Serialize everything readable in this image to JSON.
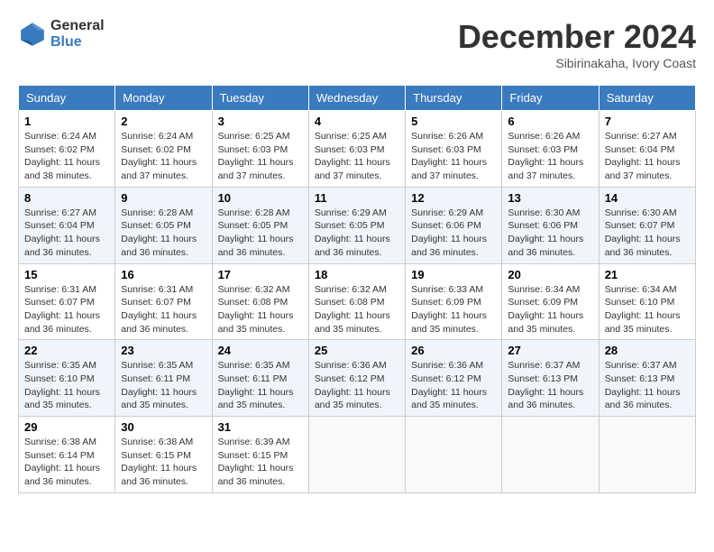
{
  "logo": {
    "general": "General",
    "blue": "Blue"
  },
  "title": "December 2024",
  "location": "Sibirinakaha, Ivory Coast",
  "weekdays": [
    "Sunday",
    "Monday",
    "Tuesday",
    "Wednesday",
    "Thursday",
    "Friday",
    "Saturday"
  ],
  "weeks": [
    [
      {
        "day": "1",
        "sunrise": "6:24 AM",
        "sunset": "6:02 PM",
        "daylight": "11 hours and 38 minutes."
      },
      {
        "day": "2",
        "sunrise": "6:24 AM",
        "sunset": "6:02 PM",
        "daylight": "11 hours and 37 minutes."
      },
      {
        "day": "3",
        "sunrise": "6:25 AM",
        "sunset": "6:03 PM",
        "daylight": "11 hours and 37 minutes."
      },
      {
        "day": "4",
        "sunrise": "6:25 AM",
        "sunset": "6:03 PM",
        "daylight": "11 hours and 37 minutes."
      },
      {
        "day": "5",
        "sunrise": "6:26 AM",
        "sunset": "6:03 PM",
        "daylight": "11 hours and 37 minutes."
      },
      {
        "day": "6",
        "sunrise": "6:26 AM",
        "sunset": "6:03 PM",
        "daylight": "11 hours and 37 minutes."
      },
      {
        "day": "7",
        "sunrise": "6:27 AM",
        "sunset": "6:04 PM",
        "daylight": "11 hours and 37 minutes."
      }
    ],
    [
      {
        "day": "8",
        "sunrise": "6:27 AM",
        "sunset": "6:04 PM",
        "daylight": "11 hours and 36 minutes."
      },
      {
        "day": "9",
        "sunrise": "6:28 AM",
        "sunset": "6:05 PM",
        "daylight": "11 hours and 36 minutes."
      },
      {
        "day": "10",
        "sunrise": "6:28 AM",
        "sunset": "6:05 PM",
        "daylight": "11 hours and 36 minutes."
      },
      {
        "day": "11",
        "sunrise": "6:29 AM",
        "sunset": "6:05 PM",
        "daylight": "11 hours and 36 minutes."
      },
      {
        "day": "12",
        "sunrise": "6:29 AM",
        "sunset": "6:06 PM",
        "daylight": "11 hours and 36 minutes."
      },
      {
        "day": "13",
        "sunrise": "6:30 AM",
        "sunset": "6:06 PM",
        "daylight": "11 hours and 36 minutes."
      },
      {
        "day": "14",
        "sunrise": "6:30 AM",
        "sunset": "6:07 PM",
        "daylight": "11 hours and 36 minutes."
      }
    ],
    [
      {
        "day": "15",
        "sunrise": "6:31 AM",
        "sunset": "6:07 PM",
        "daylight": "11 hours and 36 minutes."
      },
      {
        "day": "16",
        "sunrise": "6:31 AM",
        "sunset": "6:07 PM",
        "daylight": "11 hours and 36 minutes."
      },
      {
        "day": "17",
        "sunrise": "6:32 AM",
        "sunset": "6:08 PM",
        "daylight": "11 hours and 35 minutes."
      },
      {
        "day": "18",
        "sunrise": "6:32 AM",
        "sunset": "6:08 PM",
        "daylight": "11 hours and 35 minutes."
      },
      {
        "day": "19",
        "sunrise": "6:33 AM",
        "sunset": "6:09 PM",
        "daylight": "11 hours and 35 minutes."
      },
      {
        "day": "20",
        "sunrise": "6:34 AM",
        "sunset": "6:09 PM",
        "daylight": "11 hours and 35 minutes."
      },
      {
        "day": "21",
        "sunrise": "6:34 AM",
        "sunset": "6:10 PM",
        "daylight": "11 hours and 35 minutes."
      }
    ],
    [
      {
        "day": "22",
        "sunrise": "6:35 AM",
        "sunset": "6:10 PM",
        "daylight": "11 hours and 35 minutes."
      },
      {
        "day": "23",
        "sunrise": "6:35 AM",
        "sunset": "6:11 PM",
        "daylight": "11 hours and 35 minutes."
      },
      {
        "day": "24",
        "sunrise": "6:35 AM",
        "sunset": "6:11 PM",
        "daylight": "11 hours and 35 minutes."
      },
      {
        "day": "25",
        "sunrise": "6:36 AM",
        "sunset": "6:12 PM",
        "daylight": "11 hours and 35 minutes."
      },
      {
        "day": "26",
        "sunrise": "6:36 AM",
        "sunset": "6:12 PM",
        "daylight": "11 hours and 35 minutes."
      },
      {
        "day": "27",
        "sunrise": "6:37 AM",
        "sunset": "6:13 PM",
        "daylight": "11 hours and 36 minutes."
      },
      {
        "day": "28",
        "sunrise": "6:37 AM",
        "sunset": "6:13 PM",
        "daylight": "11 hours and 36 minutes."
      }
    ],
    [
      {
        "day": "29",
        "sunrise": "6:38 AM",
        "sunset": "6:14 PM",
        "daylight": "11 hours and 36 minutes."
      },
      {
        "day": "30",
        "sunrise": "6:38 AM",
        "sunset": "6:15 PM",
        "daylight": "11 hours and 36 minutes."
      },
      {
        "day": "31",
        "sunrise": "6:39 AM",
        "sunset": "6:15 PM",
        "daylight": "11 hours and 36 minutes."
      },
      null,
      null,
      null,
      null
    ]
  ]
}
